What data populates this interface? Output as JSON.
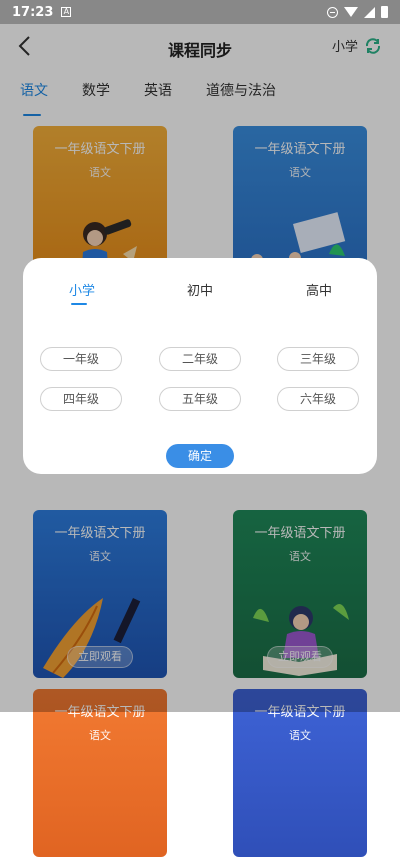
{
  "status_bar": {
    "time": "17:23",
    "notif_letter": "A"
  },
  "nav": {
    "title": "课程同步",
    "level_label": "小学"
  },
  "tabs": [
    {
      "label": "语文",
      "active": true
    },
    {
      "label": "数学",
      "active": false
    },
    {
      "label": "英语",
      "active": false
    },
    {
      "label": "道德与法治",
      "active": false
    }
  ],
  "cards": [
    {
      "title": "一年级语文下册",
      "subject": "语文",
      "color_top": "#f6b13b",
      "color_bottom": "#e88a16",
      "has_button": false
    },
    {
      "title": "一年级语文下册",
      "subject": "语文",
      "color_top": "#3a8fe0",
      "color_bottom": "#2a6fc6",
      "has_button": false
    },
    {
      "title": "一年级语文下册",
      "subject": "语文",
      "color_top": "#2e7ee0",
      "color_bottom": "#1f56b6",
      "has_button": true,
      "button_label": "立即观看"
    },
    {
      "title": "一年级语文下册",
      "subject": "语文",
      "color_top": "#1f8a5a",
      "color_bottom": "#1b6e47",
      "has_button": true,
      "button_label": "立即观看"
    },
    {
      "title": "一年级语文下册",
      "subject": "语文",
      "color_top": "#f27a32",
      "color_bottom": "#e06422",
      "has_button": false
    },
    {
      "title": "一年级语文下册",
      "subject": "语文",
      "color_top": "#3e63d6",
      "color_bottom": "#2f4fb8",
      "has_button": false
    }
  ],
  "modal": {
    "tabs": [
      {
        "label": "小学",
        "active": true
      },
      {
        "label": "初中",
        "active": false
      },
      {
        "label": "高中",
        "active": false
      }
    ],
    "grades": [
      "一年级",
      "二年级",
      "三年级",
      "四年级",
      "五年级",
      "六年级"
    ],
    "confirm_label": "确定"
  },
  "colors": {
    "accent": "#1e88e5",
    "confirm_bg": "#3a8ee6"
  }
}
